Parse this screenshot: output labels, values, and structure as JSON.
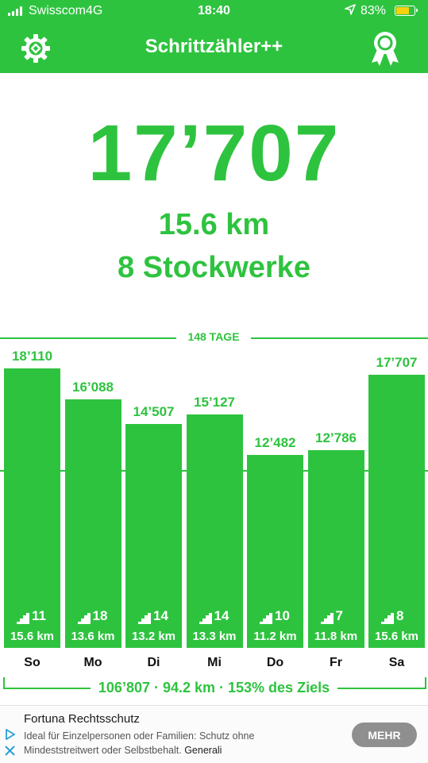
{
  "status_bar": {
    "carrier": "Swisscom",
    "network": "4G",
    "time": "18:40",
    "battery_percent": "83%",
    "battery_level": 0.83
  },
  "header": {
    "title": "Schrittzähler++"
  },
  "today": {
    "steps": "17’707",
    "distance": "15.6 km",
    "floors": "8 Stockwerke"
  },
  "history": {
    "days_label": "148 TAGE",
    "summary": "106’807 · 94.2 km · 153% des Ziels"
  },
  "chart_data": {
    "type": "bar",
    "categories": [
      "So",
      "Mo",
      "Di",
      "Mi",
      "Do",
      "Fr",
      "Sa"
    ],
    "values": [
      18110,
      16088,
      14507,
      15127,
      12482,
      12786,
      17707
    ],
    "value_labels": [
      "18’110",
      "16’088",
      "14’507",
      "15’127",
      "12’482",
      "12’786",
      "17’707"
    ],
    "floors": [
      "11",
      "18",
      "14",
      "14",
      "10",
      "7",
      "8"
    ],
    "distances": [
      "15.6 km",
      "13.6 km",
      "13.2 km",
      "13.3 km",
      "11.2 km",
      "11.8 km",
      "15.6 km"
    ],
    "goal_line": 11500,
    "colors": {
      "bar": "#2ec33f",
      "label": "#2ec33f",
      "day": "#111111"
    }
  },
  "ad": {
    "title": "Fortuna Rechtsschutz",
    "text": "Ideal für Einzelpersonen oder Familien: Schutz ohne Mindeststreitwert oder Selbstbehalt.",
    "brand": "Generali",
    "button_label": "MEHR"
  },
  "colors": {
    "accent": "#2ec33f",
    "battery": "#f6d10e",
    "ad_button": "#8f8f8f"
  }
}
